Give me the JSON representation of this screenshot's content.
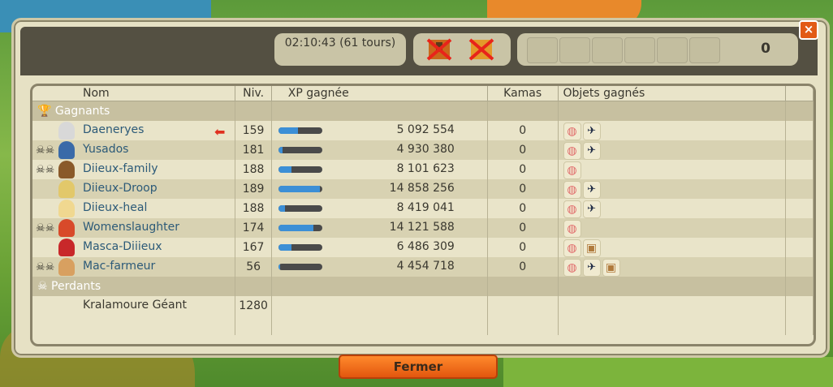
{
  "header": {
    "timer": "02:10:43 (61 tours)",
    "slot_count": "0",
    "close_label": "×"
  },
  "table": {
    "columns": [
      "Nom",
      "Niv.",
      "XP gagnée",
      "Kamas",
      "Objets gagnés"
    ],
    "winners_label": "Gagnants",
    "losers_label": "Perdants",
    "winners": [
      {
        "name": "Daeneryes",
        "level": "159",
        "xp": "5 092 554",
        "kamas": "0",
        "xp_fill": 0.45,
        "dead": false,
        "arrow": true,
        "objects": [
          "ring",
          "bird"
        ]
      },
      {
        "name": "Yusados",
        "level": "181",
        "xp": "4 930 380",
        "kamas": "0",
        "xp_fill": 0.1,
        "dead": true,
        "arrow": false,
        "objects": [
          "ring",
          "bird"
        ]
      },
      {
        "name": "Diieux-family",
        "level": "188",
        "xp": "8 101 623",
        "kamas": "0",
        "xp_fill": 0.3,
        "dead": true,
        "arrow": false,
        "objects": [
          "ring"
        ]
      },
      {
        "name": "Diieux-Droop",
        "level": "189",
        "xp": "14 858 256",
        "kamas": "0",
        "xp_fill": 0.95,
        "dead": false,
        "arrow": false,
        "objects": [
          "ring",
          "bird"
        ]
      },
      {
        "name": "Diieux-heal",
        "level": "188",
        "xp": "8 419 041",
        "kamas": "0",
        "xp_fill": 0.15,
        "dead": false,
        "arrow": false,
        "objects": [
          "ring",
          "bird"
        ]
      },
      {
        "name": "Womenslaughter",
        "level": "174",
        "xp": "14 121 588",
        "kamas": "0",
        "xp_fill": 0.8,
        "dead": true,
        "arrow": false,
        "objects": [
          "ring"
        ]
      },
      {
        "name": "Masca-Diiieux",
        "level": "167",
        "xp": "6 486 309",
        "kamas": "0",
        "xp_fill": 0.3,
        "dead": false,
        "arrow": false,
        "objects": [
          "ring",
          "bag"
        ]
      },
      {
        "name": "Mac-farmeur",
        "level": "56",
        "xp": "4 454 718",
        "kamas": "0",
        "xp_fill": 0.05,
        "dead": true,
        "arrow": false,
        "objects": [
          "ring",
          "bird",
          "bag"
        ]
      }
    ],
    "losers": [
      {
        "name": "Kralamoure Géant",
        "level": "1280"
      }
    ]
  },
  "footer": {
    "close_button": "Fermer"
  },
  "colors": {
    "accent": "#e25a16",
    "xp_bar": "#3c8fd6",
    "player_name": "#2c5a78"
  }
}
